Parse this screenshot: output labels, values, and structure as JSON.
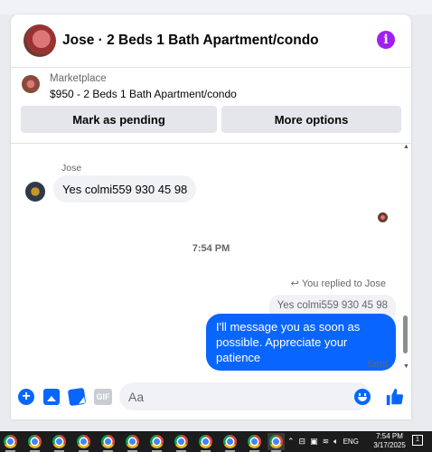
{
  "header": {
    "title": "Jose · 2 Beds 1 Bath Apartment/condo",
    "info_icon": "info-icon"
  },
  "listing": {
    "source": "Marketplace",
    "price_title": "$950 - 2 Beds 1 Bath Apartment/condo",
    "buttons": {
      "pending": "Mark as pending",
      "more": "More options"
    }
  },
  "conversation": {
    "incoming": {
      "sender": "Jose",
      "text": "Yes colmi559 930 45 98"
    },
    "timestamp": "7:54 PM",
    "reply": {
      "label": "You replied to Jose",
      "quoted": "Yes colmi559 930 45 98",
      "text": "I'll message you as soon as possible. Appreciate your patience",
      "status": "Sent"
    }
  },
  "composer": {
    "placeholder": "Aa",
    "icons": [
      "plus-icon",
      "image-icon",
      "sticker-icon",
      "gif-icon",
      "emoji-icon",
      "like-icon"
    ],
    "gif_label": "GIF"
  },
  "colors": {
    "accent": "#0866ff",
    "info": "#a020f0"
  },
  "taskbar": {
    "app_count": 11,
    "language": "ENG",
    "time": "7:54 PM",
    "date": "3/17/2025",
    "notification_count": "1"
  }
}
